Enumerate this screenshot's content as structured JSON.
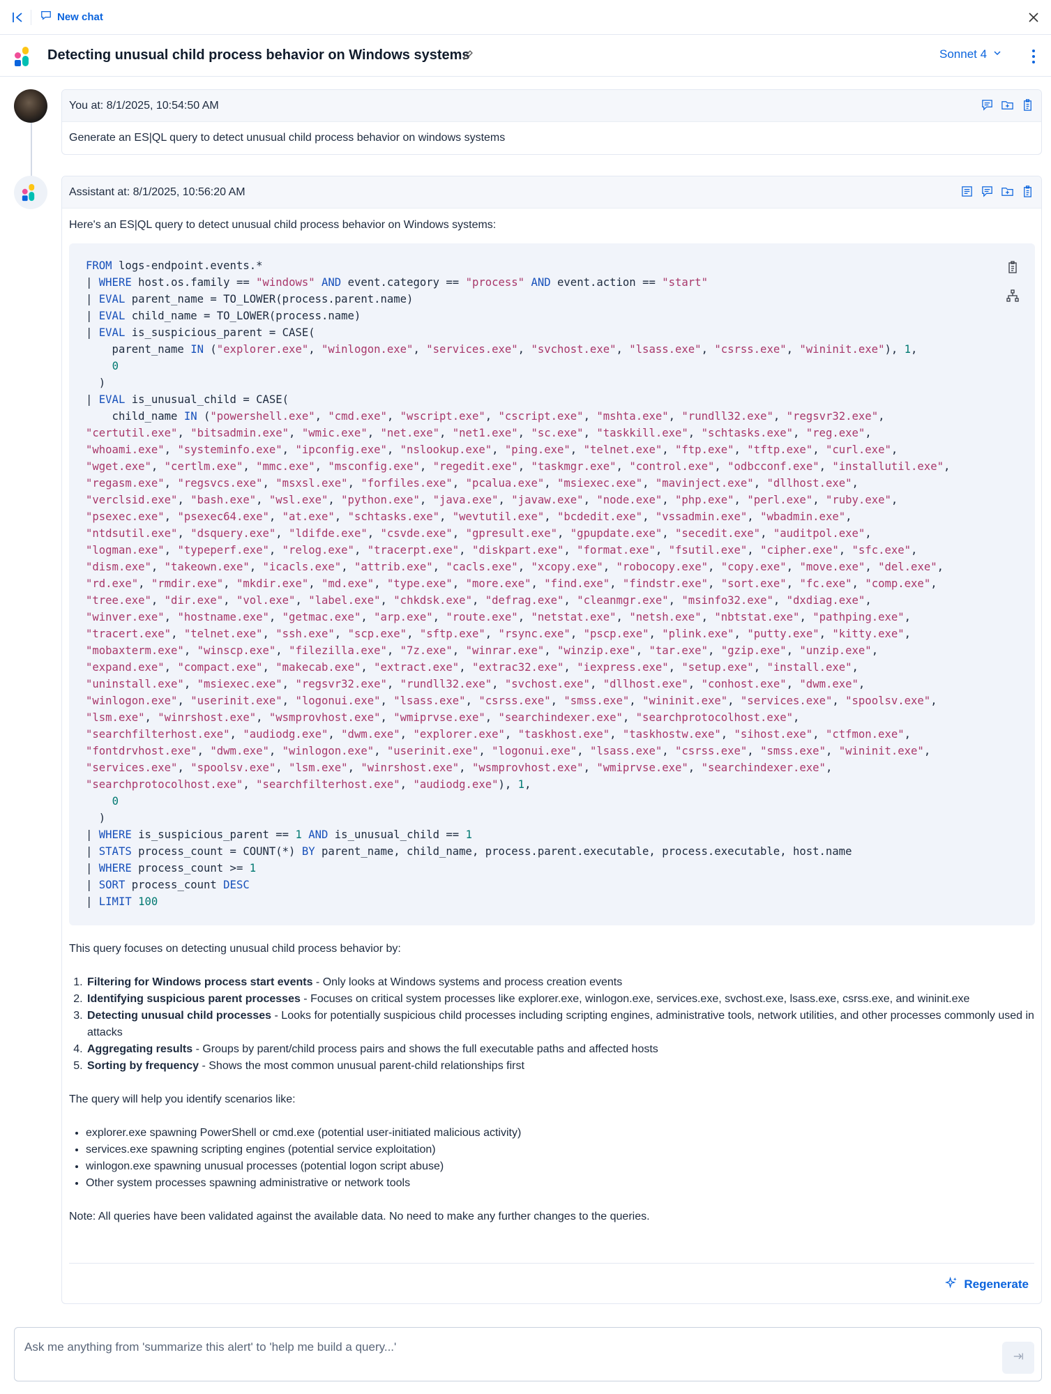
{
  "topbar": {
    "new_chat_label": "New chat"
  },
  "conversation": {
    "title": "Detecting unusual child process behavior on Windows systems",
    "model": "Sonnet 4"
  },
  "user_message": {
    "header": "You at: 8/1/2025, 10:54:50 AM",
    "text": "Generate an ES|QL query to detect unusual child process behavior on windows systems"
  },
  "assistant_message": {
    "header": "Assistant at: 8/1/2025, 10:56:20 AM",
    "intro": "Here's an ES|QL query to detect unusual child process behavior on Windows systems:",
    "summary_intro": "This query focuses on detecting unusual child process behavior by:",
    "steps": [
      {
        "title": "Filtering for Windows process start events",
        "text": " - Only looks at Windows systems and process creation events"
      },
      {
        "title": "Identifying suspicious parent processes",
        "text": " - Focuses on critical system processes like explorer.exe, winlogon.exe, services.exe, svchost.exe, lsass.exe, csrss.exe, and wininit.exe"
      },
      {
        "title": "Detecting unusual child processes",
        "text": " - Looks for potentially suspicious child processes including scripting engines, administrative tools, network utilities, and other processes commonly used in attacks"
      },
      {
        "title": "Aggregating results",
        "text": " - Groups by parent/child process pairs and shows the full executable paths and affected hosts"
      },
      {
        "title": "Sorting by frequency",
        "text": " - Shows the most common unusual parent-child relationships first"
      }
    ],
    "scenarios_intro": "The query will help you identify scenarios like:",
    "scenarios": [
      "explorer.exe spawning PowerShell or cmd.exe (potential user-initiated malicious activity)",
      "services.exe spawning scripting engines (potential service exploitation)",
      "winlogon.exe spawning unusual processes (potential logon script abuse)",
      "Other system processes spawning administrative or network tools"
    ],
    "note": "Note: All queries have been validated against the available data. No need to make any further changes to the queries.",
    "regenerate_label": "Regenerate"
  },
  "composer": {
    "placeholder": "Ask me anything from 'summarize this alert' to 'help me build a query...'"
  }
}
